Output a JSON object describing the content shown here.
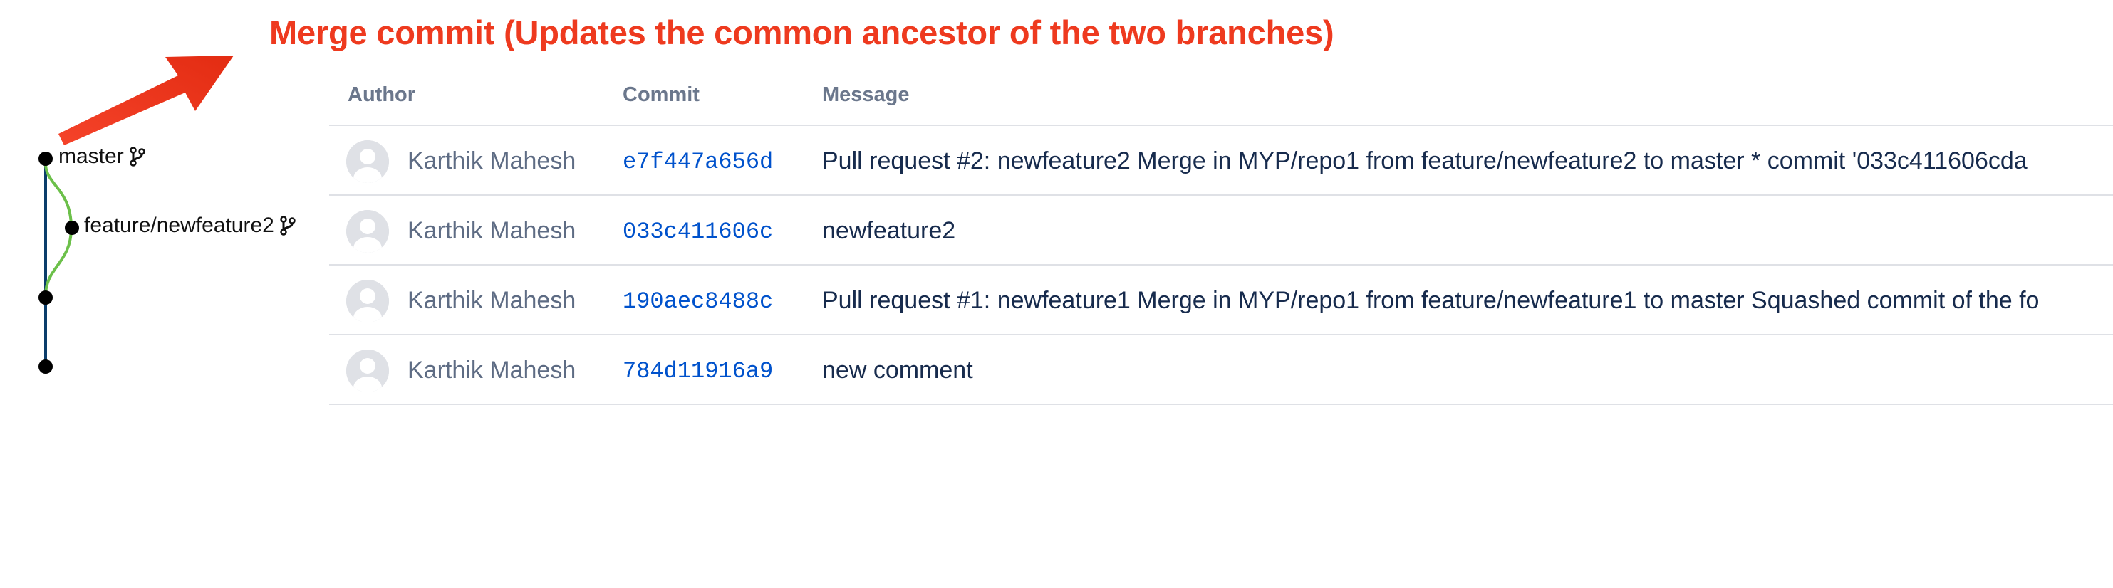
{
  "annotation": {
    "title": "Merge commit (Updates the common ancestor of the two branches)",
    "color": "#ee3a1f"
  },
  "graph": {
    "branches": [
      {
        "name": "master",
        "icon": "branch-icon"
      },
      {
        "name": "feature/newfeature2",
        "icon": "branch-icon"
      }
    ],
    "colors": {
      "main_line": "#0b3d6b",
      "feature_line": "#6cc04a",
      "node": "#000000"
    }
  },
  "table": {
    "headers": {
      "author": "Author",
      "commit": "Commit",
      "message": "Message"
    },
    "rows": [
      {
        "author": "Karthik Mahesh",
        "commit": "e7f447a656d",
        "message": "Pull request #2: newfeature2 Merge in MYP/repo1 from feature/newfeature2 to master * commit '033c411606cda"
      },
      {
        "author": "Karthik Mahesh",
        "commit": "033c411606c",
        "message": "newfeature2"
      },
      {
        "author": "Karthik Mahesh",
        "commit": "190aec8488c",
        "message": "Pull request #1: newfeature1 Merge in MYP/repo1 from feature/newfeature1 to master Squashed commit of the fo"
      },
      {
        "author": "Karthik Mahesh",
        "commit": "784d11916a9",
        "message": "new comment"
      }
    ],
    "colors": {
      "header_text": "#6b778c",
      "author_text": "#5e6c84",
      "commit_link": "#0052cc",
      "message_text": "#172b4d",
      "row_border": "#dfe1e6"
    }
  }
}
